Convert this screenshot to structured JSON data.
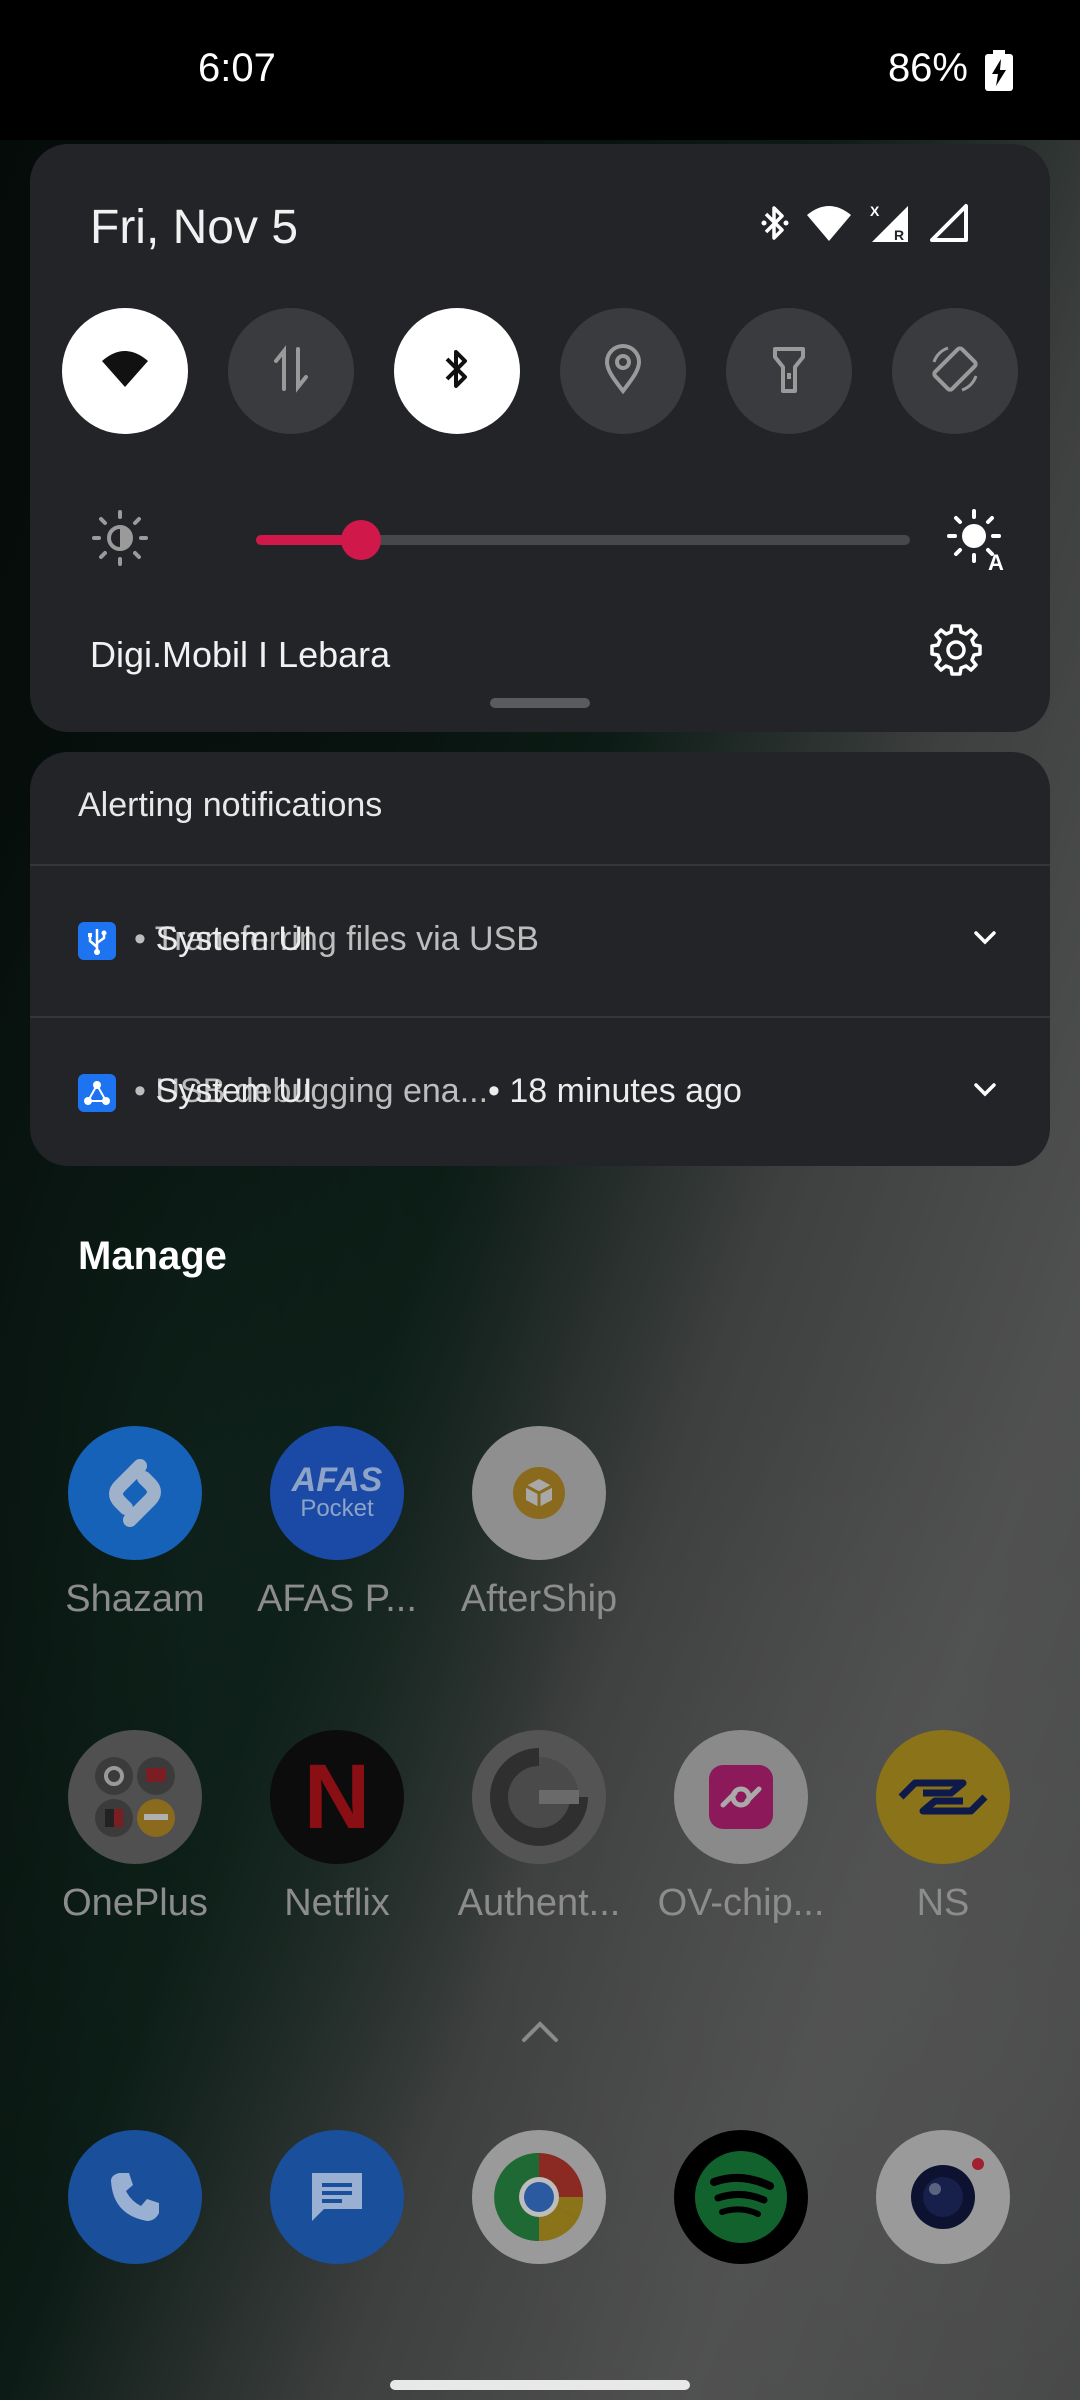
{
  "status_bar": {
    "time": "6:07",
    "battery": "86%"
  },
  "quick_settings": {
    "date": "Fri, Nov 5",
    "carrier": "Digi.Mobil I Lebara",
    "tiles": [
      {
        "name": "wifi",
        "state": "on"
      },
      {
        "name": "mobile-data",
        "state": "off"
      },
      {
        "name": "bluetooth",
        "state": "on"
      },
      {
        "name": "location",
        "state": "off"
      },
      {
        "name": "flashlight",
        "state": "off"
      },
      {
        "name": "auto-rotate",
        "state": "off"
      }
    ],
    "brightness_level": 0.16,
    "accent_color": "#d0184a"
  },
  "notifications": {
    "header": "Alerting notifications",
    "items": [
      {
        "app": "System UI",
        "text": "• Transferring files via USB",
        "time": ""
      },
      {
        "app": "System UI",
        "text": "• USB debugging ena...",
        "time": "• 18 minutes ago"
      }
    ]
  },
  "manage_label": "Manage",
  "apps_row1": [
    {
      "label": "Shazam",
      "icon": "shazam-icon"
    },
    {
      "label": "AFAS P...",
      "icon": "afas-pocket-icon",
      "icon_text_top": "AFAS",
      "icon_text_bottom": "Pocket"
    },
    {
      "label": "AfterShip",
      "icon": "aftership-icon"
    }
  ],
  "apps_row2": [
    {
      "label": "OnePlus",
      "icon": "oneplus-folder-icon"
    },
    {
      "label": "Netflix",
      "icon": "netflix-icon",
      "icon_text": "N"
    },
    {
      "label": "Authent...",
      "icon": "authenticator-icon"
    },
    {
      "label": "OV-chip...",
      "icon": "ov-chipkaart-icon"
    },
    {
      "label": "NS",
      "icon": "ns-icon"
    }
  ],
  "dock": [
    {
      "icon": "phone-icon"
    },
    {
      "icon": "messages-icon"
    },
    {
      "icon": "chrome-icon"
    },
    {
      "icon": "spotify-icon"
    },
    {
      "icon": "camera-icon"
    }
  ]
}
